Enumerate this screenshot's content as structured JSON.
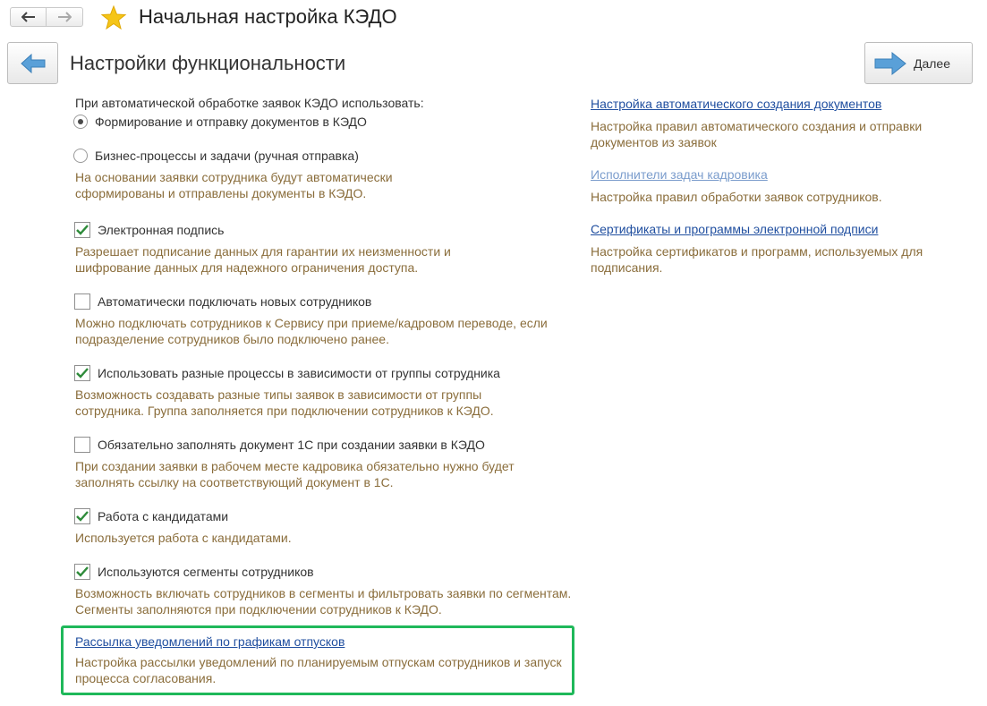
{
  "window": {
    "title": "Начальная настройка КЭДО"
  },
  "toolbar": {
    "next_label": "Далее"
  },
  "page": {
    "title": "Настройки функциональности"
  },
  "settings": {
    "intro": "При автоматической обработке заявок КЭДО использовать:",
    "radio_options": [
      {
        "label": "Формирование и отправку документов в КЭДО",
        "selected": true
      },
      {
        "label": "Бизнес-процессы и задачи (ручная отправка)",
        "selected": false
      }
    ],
    "radio_desc": "На основании заявки сотрудника будут автоматически сформированы и отправлены документы в КЭДО.",
    "checkboxes": [
      {
        "label": "Электронная подпись",
        "checked": true,
        "desc": "Разрешает подписание данных для гарантии их неизменности и шифрование данных для надежного ограничения доступа."
      },
      {
        "label": "Автоматически подключать новых сотрудников",
        "checked": false,
        "desc": "Можно подключать сотрудников к Сервису при приеме/кадровом переводе, если подразделение сотрудников было подключено ранее."
      },
      {
        "label": "Использовать разные процессы в зависимости от группы сотрудника",
        "checked": true,
        "desc": "Возможность создавать разные типы заявок в зависимости от группы сотрудника. Группа заполняется при подключении сотрудников к КЭДО."
      },
      {
        "label": "Обязательно заполнять документ 1С при создании заявки в КЭДО",
        "checked": false,
        "desc": "При создании заявки в рабочем месте кадровика обязательно нужно будет заполнять ссылку на соответствующий документ в 1С."
      },
      {
        "label": "Работа с кандидатами",
        "checked": true,
        "desc": "Используется работа с кандидатами."
      },
      {
        "label": "Используются сегменты сотрудников",
        "checked": true,
        "desc": "Возможность включать сотрудников в сегменты и фильтровать заявки по сегментам. Сегменты заполняются при подключении сотрудников к КЭДО."
      }
    ],
    "vacation_link": {
      "label": "Рассылка уведомлений по графикам отпусков",
      "desc": "Настройка рассылки уведомлений по планируемым отпускам сотрудников и запуск процесса согласования."
    }
  },
  "right_links": [
    {
      "label": "Настройка автоматического создания документов",
      "desc": "Настройка правил автоматического создания и отправки документов из заявок"
    },
    {
      "label": "Исполнители задач кадровика",
      "desc": "Настройка правил обработки заявок сотрудников."
    },
    {
      "label": "Сертификаты и программы электронной подписи",
      "desc": "Настройка сертификатов и программ, используемых для подписания."
    }
  ],
  "colors": {
    "accent_link": "#1f4e9f",
    "description": "#8a6d3b",
    "highlight": "#1fb85a",
    "check": "#2e8b3a"
  }
}
